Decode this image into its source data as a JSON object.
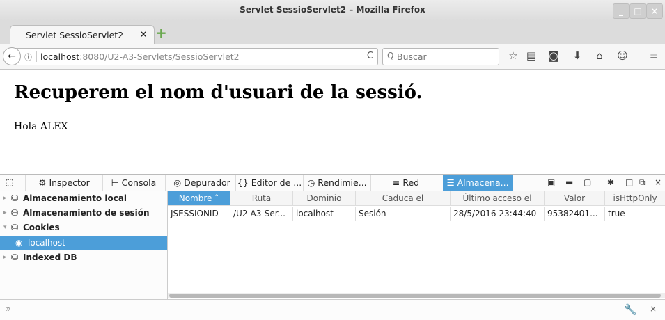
{
  "window": {
    "title": "Servlet SessioServlet2 – Mozilla Firefox",
    "controls": [
      "_",
      "□",
      "×"
    ]
  },
  "tab": {
    "label": "Servlet SessioServlet2",
    "close": "×",
    "new_tab": "+"
  },
  "navbar": {
    "back": "←",
    "info": "ⓘ",
    "url_host": "localhost",
    "url_path": ":8080/U2-A3-Servlets/SessioServlet2",
    "reload": "C",
    "search_icon": "Q",
    "search_placeholder": "Buscar",
    "icons": [
      "star-icon",
      "reading-list-icon",
      "pocket-icon",
      "download-icon",
      "home-icon",
      "chat-icon",
      "menu-icon"
    ]
  },
  "page": {
    "heading": "Recuperem el nom d'usuari de la sessió.",
    "greeting": "Hola ALEX"
  },
  "devtools": {
    "tabs": [
      "Inspector",
      "Consola",
      "Depurador",
      "Editor de ...",
      "Rendimie...",
      "Red",
      "Almacena..."
    ],
    "selected_tab": "Almacena...",
    "sidebar": [
      {
        "label": "Almacenamiento local",
        "expanded": false
      },
      {
        "label": "Almacenamiento de sesión",
        "expanded": false
      },
      {
        "label": "Cookies",
        "expanded": true
      },
      {
        "label": "localhost",
        "selected": true
      },
      {
        "label": "Indexed DB",
        "expanded": false
      }
    ],
    "columns": [
      "Nombre",
      "Ruta",
      "Dominio",
      "Caduca el",
      "Último acceso el",
      "Valor",
      "isHttpOnly"
    ],
    "sorted_column": "Nombre",
    "sort_indicator": "˄",
    "rows": [
      [
        "JSESSIONID",
        "/U2-A3-Ser...",
        "localhost",
        "Sesión",
        "28/5/2016 23:44:40",
        "95382401...",
        "true"
      ]
    ],
    "console_prompt": "»",
    "accent_color": "#4c9ed9"
  }
}
